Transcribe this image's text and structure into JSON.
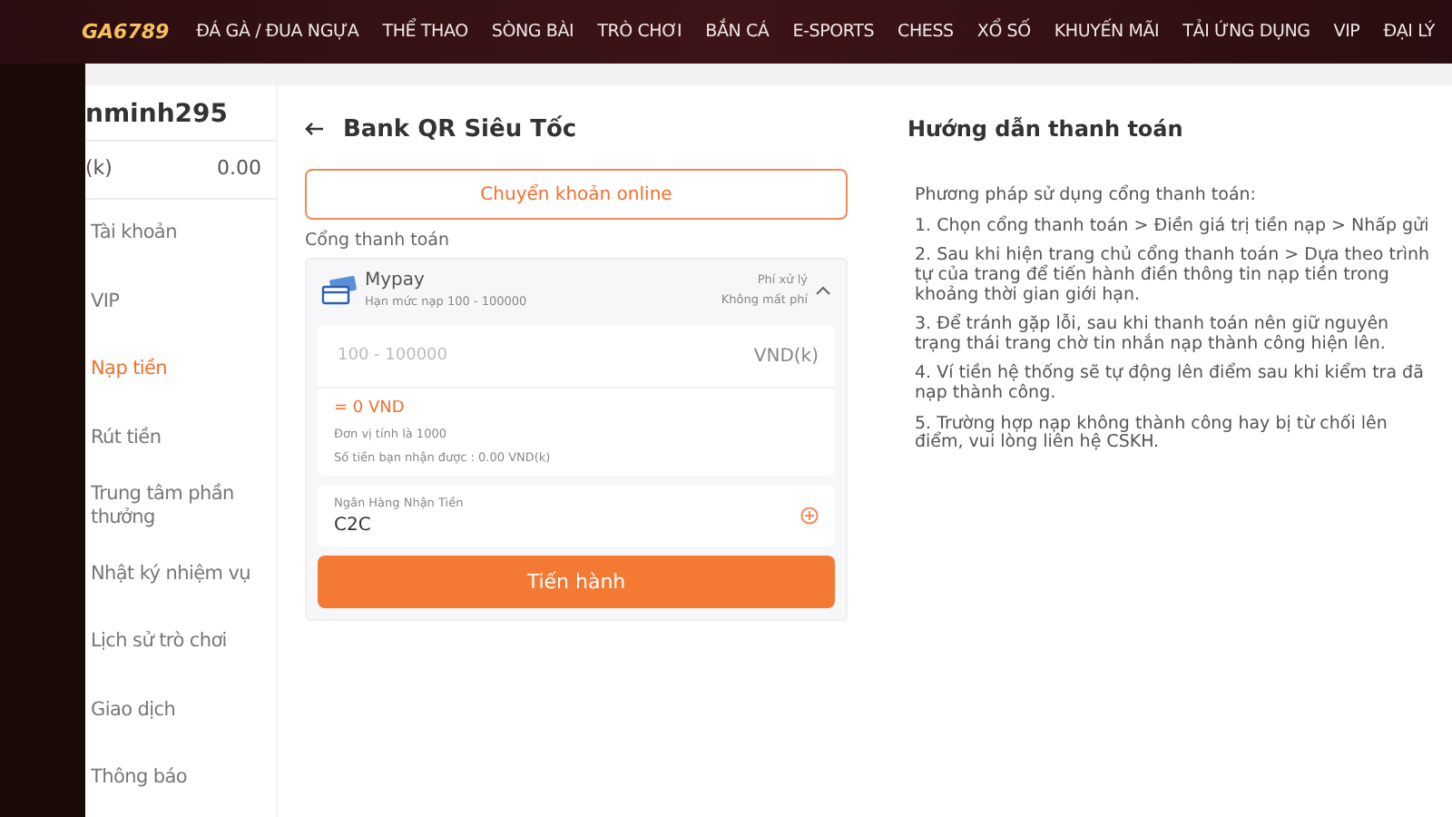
{
  "nav": {
    "logo": "GA6789",
    "items": [
      "ĐÁ GÀ / ĐUA NGỰA",
      "THỂ THAO",
      "SÒNG BÀI",
      "TRÒ CHƠI",
      "BẮN CÁ",
      "E-SPORTS",
      "CHESS",
      "XỔ SỐ",
      "KHUYẾN MÃI",
      "TẢI ỨNG DỤNG",
      "VIP",
      "ĐẠI LÝ"
    ]
  },
  "sidebar": {
    "username": "nminh295",
    "balance_label": "(k)",
    "balance": "0.00",
    "items": [
      {
        "label": "Tài khoản",
        "selected": false
      },
      {
        "label": "VIP",
        "selected": false
      },
      {
        "label": "Nạp tiền",
        "selected": true
      },
      {
        "label": "Rút tiền",
        "selected": false
      },
      {
        "label": "Trung tâm phần thưởng",
        "selected": false
      },
      {
        "label": "Nhật ký nhiệm vụ",
        "selected": false
      },
      {
        "label": "Lịch sử trò chơi",
        "selected": false
      },
      {
        "label": "Giao dịch",
        "selected": false
      },
      {
        "label": "Thông báo",
        "selected": false
      }
    ]
  },
  "deposit": {
    "title": "Bank QR Siêu Tốc",
    "method_button": "Chuyển khoản online",
    "gateway_label": "Cổng thanh toán",
    "gateway": {
      "name": "Mypay",
      "limit": "Hạn mức nạp 100 - 100000",
      "fee_label": "Phí xử lý",
      "fee": "Không mất phí",
      "expanded": true
    },
    "amount": {
      "placeholder": "100 - 100000",
      "unit": "VND(k)"
    },
    "converted": "= 0 VND",
    "unit_note": "Đơn vị tính là 1000",
    "received": "Số tiền bạn nhận được : 0.00 VND(k)",
    "bank": {
      "label": "Ngân Hàng Nhận Tiền",
      "value": "C2C"
    },
    "submit": "Tiến hành"
  },
  "guide": {
    "title": "Hướng dẫn thanh toán",
    "intro": "Phương pháp sử dụng cổng thanh toán:",
    "steps": [
      "1. Chọn cổng thanh toán > Điền giá trị tiền nạp > Nhấp gửi",
      "2. Sau khi hiện trang chủ cổng thanh toán > Dựa theo trình tự của trang để tiến hành điền thông tin nạp tiền trong khoảng thời gian giới hạn.",
      "3. Để tránh gặp lỗi, sau khi thanh toán nên giữ nguyên trạng thái trang chờ tin nhắn nạp thành công hiện lên.",
      "4. Ví tiền hệ thống sẽ tự động lên điểm sau khi kiểm tra đã nạp thành công.",
      "5. Trường hợp nạp không thành công hay bị từ chối lên điểm, vui lòng liên hệ CSKH."
    ]
  }
}
